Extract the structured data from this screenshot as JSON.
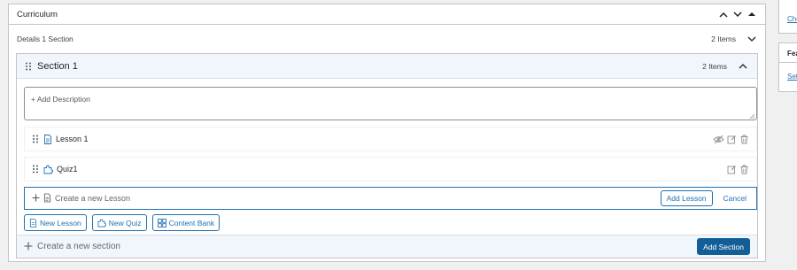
{
  "curriculum": {
    "title": "Curriculum",
    "details_label": "Details  1 Section",
    "details_count": "2 Items"
  },
  "section": {
    "title": "Section 1",
    "count": "2 Items",
    "description_placeholder": "+ Add Description",
    "items": [
      {
        "title": "Lesson 1",
        "type": "lesson",
        "icon": "document-icon"
      },
      {
        "title": "Quiz1",
        "type": "quiz",
        "icon": "puzzle-icon"
      }
    ],
    "new_lesson_placeholder": "Create a new Lesson",
    "add_lesson_label": "Add Lesson",
    "cancel_label": "Cancel",
    "buttons": {
      "new_lesson": "New Lesson",
      "new_quiz": "New Quiz",
      "content_bank": "Content Bank"
    }
  },
  "new_section": {
    "placeholder": "Create a new section",
    "add_label": "Add Section"
  },
  "sidebar": {
    "link1": "Cho",
    "box2_title": "Fea",
    "link2": "Set"
  },
  "colors": {
    "accent": "#2271b1",
    "primary_button": "#135e96",
    "section_header_bg": "#f0f6fc",
    "page_bg": "#f0f0f1"
  }
}
